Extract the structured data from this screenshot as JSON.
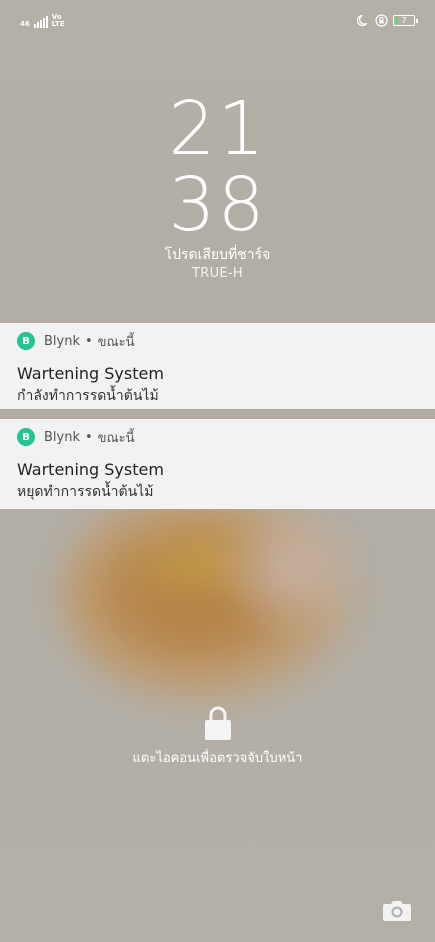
{
  "status_bar": {
    "network_tag": "46",
    "volte_top": "Vo",
    "volte_bottom": "LTE",
    "battery_level": "7",
    "icons": [
      "signal-icon",
      "moon-icon",
      "rotation-lock-icon",
      "battery-icon"
    ]
  },
  "clock": {
    "hour": "21",
    "minute": "38"
  },
  "charge_message": "โปรดเสียบที่ชาร์จ",
  "carrier": "TRUE-H",
  "notifications": [
    {
      "app_icon_letter": "B",
      "app_name": "Blynk",
      "separator": "•",
      "time": "ขณะนี้",
      "title": "Wartening System",
      "body": "กำลังทำการรดน้ำต้นไม้"
    },
    {
      "app_icon_letter": "B",
      "app_name": "Blynk",
      "separator": "•",
      "time": "ขณะนี้",
      "title": "Wartening System",
      "body": "หยุดทำการรดน้ำต้นไม้"
    }
  ],
  "lock_hint": "แตะไอคอนเพื่อตรวจจับใบหน้า",
  "colors": {
    "app_icon": "#23c48e",
    "notification_bg": "#f2f2f2",
    "wallpaper": "#b3afa6"
  }
}
